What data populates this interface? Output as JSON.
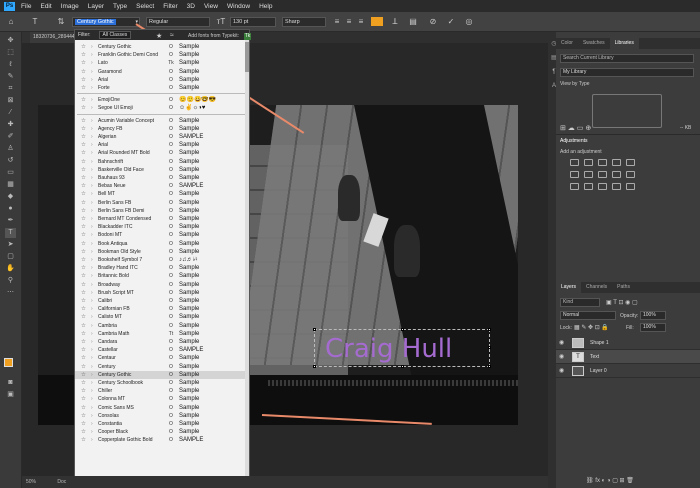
{
  "menubar": {
    "logo": "Ps",
    "items": [
      "File",
      "Edit",
      "Image",
      "Layer",
      "Type",
      "Select",
      "Filter",
      "3D",
      "View",
      "Window",
      "Help"
    ]
  },
  "options_bar": {
    "font_family": "Century Gothic",
    "font_style": "Regular",
    "font_size": "130 pt",
    "antialias": "Sharp",
    "text_color": "#f0a020"
  },
  "document": {
    "tab_title": "18320736_28944472",
    "zoom": "50%",
    "doc_label": "Doc"
  },
  "canvas_text": {
    "text": "Craig Hull",
    "color": "#a56bd0"
  },
  "font_dropdown": {
    "filter_label": "Filter:",
    "filter_value": "All Classes",
    "typekit_label": "Add fonts from Typekit:",
    "recent_fonts": [
      {
        "name": "Century Gothic",
        "type": "O",
        "sample": "Sample"
      },
      {
        "name": "Franklin Gothic Demi Cond",
        "type": "O",
        "sample": "Sample"
      },
      {
        "name": "Lato",
        "type": "Tk",
        "sample": "Sample"
      },
      {
        "name": "Garamond",
        "type": "O",
        "sample": "Sample"
      },
      {
        "name": "Arial",
        "type": "O",
        "sample": "Sample"
      },
      {
        "name": "Forte",
        "type": "O",
        "sample": "Sample"
      }
    ],
    "emoji_fonts": [
      {
        "name": "EmojiOne",
        "type": "O",
        "sample": "😊🙂😀🤓😎"
      },
      {
        "name": "Segoe UI Emoji",
        "type": "O",
        "sample": "☺✌☼◑♥"
      }
    ],
    "fonts": [
      {
        "name": "Acumin Variable Concept",
        "type": "O",
        "sample": "Sample"
      },
      {
        "name": "Agency FB",
        "type": "O",
        "sample": "Sample"
      },
      {
        "name": "Algerian",
        "type": "O",
        "sample": "SAMPLE"
      },
      {
        "name": "Arial",
        "type": "O",
        "sample": "Sample"
      },
      {
        "name": "Arial Rounded MT Bold",
        "type": "O",
        "sample": "Sample"
      },
      {
        "name": "Bahnschrift",
        "type": "O",
        "sample": "Sample"
      },
      {
        "name": "Baskerville Old Face",
        "type": "O",
        "sample": "Sample"
      },
      {
        "name": "Bauhaus 93",
        "type": "O",
        "sample": "Sample"
      },
      {
        "name": "Bebas Neue",
        "type": "O",
        "sample": "SAMPLE"
      },
      {
        "name": "Bell MT",
        "type": "O",
        "sample": "Sample"
      },
      {
        "name": "Berlin Sans FB",
        "type": "O",
        "sample": "Sample"
      },
      {
        "name": "Berlin Sans FB Demi",
        "type": "O",
        "sample": "Sample"
      },
      {
        "name": "Bernard MT Condensed",
        "type": "O",
        "sample": "Sample"
      },
      {
        "name": "Blackadder ITC",
        "type": "O",
        "sample": "Sample"
      },
      {
        "name": "Bodoni MT",
        "type": "O",
        "sample": "Sample"
      },
      {
        "name": "Book Antiqua",
        "type": "O",
        "sample": "Sample"
      },
      {
        "name": "Bookman Old Style",
        "type": "O",
        "sample": "Sample"
      },
      {
        "name": "Bookshelf Symbol 7",
        "type": "O",
        "sample": "♪♫♬♭♮"
      },
      {
        "name": "Bradley Hand ITC",
        "type": "O",
        "sample": "Sample"
      },
      {
        "name": "Britannic Bold",
        "type": "O",
        "sample": "Sample"
      },
      {
        "name": "Broadway",
        "type": "O",
        "sample": "Sample"
      },
      {
        "name": "Brush Script MT",
        "type": "O",
        "sample": "Sample"
      },
      {
        "name": "Calibri",
        "type": "O",
        "sample": "Sample"
      },
      {
        "name": "Californian FB",
        "type": "O",
        "sample": "Sample"
      },
      {
        "name": "Calisto MT",
        "type": "O",
        "sample": "Sample"
      },
      {
        "name": "Cambria",
        "type": "O",
        "sample": "Sample"
      },
      {
        "name": "Cambria Math",
        "type": "Tt",
        "sample": "Sample"
      },
      {
        "name": "Candara",
        "type": "O",
        "sample": "Sample"
      },
      {
        "name": "Castellar",
        "type": "O",
        "sample": "SAMPLE"
      },
      {
        "name": "Centaur",
        "type": "O",
        "sample": "Sample"
      },
      {
        "name": "Century",
        "type": "O",
        "sample": "Sample"
      },
      {
        "name": "Century Gothic",
        "type": "O",
        "sample": "Sample"
      },
      {
        "name": "Century Schoolbook",
        "type": "O",
        "sample": "Sample"
      },
      {
        "name": "Chiller",
        "type": "O",
        "sample": "Sample"
      },
      {
        "name": "Colonna MT",
        "type": "O",
        "sample": "Sample"
      },
      {
        "name": "Comic Sans MS",
        "type": "O",
        "sample": "Sample"
      },
      {
        "name": "Consolas",
        "type": "O",
        "sample": "Sample"
      },
      {
        "name": "Constantia",
        "type": "O",
        "sample": "Sample"
      },
      {
        "name": "Cooper Black",
        "type": "O",
        "sample": "Sample"
      },
      {
        "name": "Copperplate Gothic Bold",
        "type": "O",
        "sample": "SAMPLE"
      }
    ],
    "highlighted_index": 31
  },
  "right_panel": {
    "top_tabs": [
      "Color",
      "Swatches",
      "Libraries"
    ],
    "search_placeholder": "Search Current Library",
    "library_name": "My Library",
    "view_by": "View by Type",
    "library_size": "-- KB",
    "adjustments_title": "Adjustments",
    "add_adjustment": "Add an adjustment",
    "layer_tabs": [
      "Layers",
      "Channels",
      "Paths"
    ],
    "kind_label": "Kind",
    "blend_mode": "Normal",
    "opacity_label": "Opacity:",
    "opacity_value": "100%",
    "lock_label": "Lock:",
    "fill_label": "Fill:",
    "fill_value": "100%",
    "layers": [
      {
        "name": "Shape 1",
        "thumb": ""
      },
      {
        "name": "Text",
        "thumb": "T"
      },
      {
        "name": "Layer 0",
        "thumb": ""
      }
    ],
    "selected_layer": 1
  },
  "accent_arrow_color": "#e88a6a"
}
